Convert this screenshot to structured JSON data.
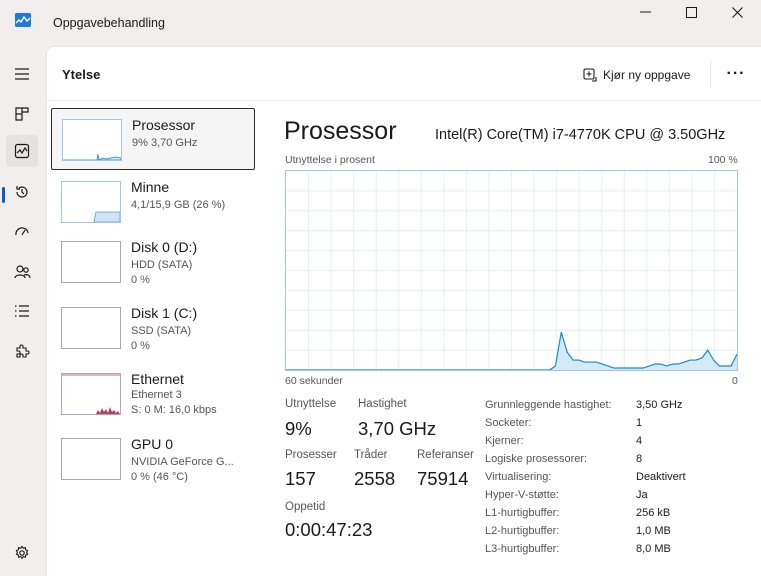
{
  "window": {
    "title": "Oppgavebehandling"
  },
  "header": {
    "title": "Ytelse",
    "run_task_label": "Kjør ny oppgave"
  },
  "devices": [
    {
      "name": "Prosessor",
      "line1": "9% 3,70 GHz"
    },
    {
      "name": "Minne",
      "line1": "4,1/15,9 GB (26 %)"
    },
    {
      "name": "Disk 0 (D:)",
      "line1": "HDD (SATA)",
      "line2": "0 %"
    },
    {
      "name": "Disk 1 (C:)",
      "line1": "SSD (SATA)",
      "line2": "0 %"
    },
    {
      "name": "Ethernet",
      "line1": "Ethernet 3",
      "line2": "S: 0 M: 16,0 kbps"
    },
    {
      "name": "GPU 0",
      "line1": "NVIDIA GeForce G...",
      "line2": "0 % (46 °C)"
    }
  ],
  "detail": {
    "title": "Prosessor",
    "model": "Intel(R) Core(TM) i7-4770K CPU @ 3.50GHz",
    "graph_label": "Utnyttelse i prosent",
    "graph_max": "100 %",
    "graph_time": "60 sekunder",
    "graph_min": "0",
    "stats": {
      "util_label": "Utnyttelse",
      "util_value": "9%",
      "speed_label": "Hastighet",
      "speed_value": "3,70 GHz",
      "proc_label": "Prosesser",
      "proc_value": "157",
      "threads_label": "Tråder",
      "threads_value": "2558",
      "handles_label": "Referanser",
      "handles_value": "75914",
      "uptime_label": "Oppetid",
      "uptime_value": "0:00:47:23"
    },
    "info": [
      {
        "key": "Grunnleggende hastighet:",
        "value": "3,50 GHz"
      },
      {
        "key": "Socketer:",
        "value": "1"
      },
      {
        "key": "Kjerner:",
        "value": "4"
      },
      {
        "key": "Logiske prosessorer:",
        "value": "8"
      },
      {
        "key": "Virtualisering:",
        "value": "Deaktivert"
      },
      {
        "key": "Hyper-V-støtte:",
        "value": "Ja"
      },
      {
        "key": "L1-hurtigbuffer:",
        "value": "256 kB"
      },
      {
        "key": "L2-hurtigbuffer:",
        "value": "1,0 MB"
      },
      {
        "key": "L3-hurtigbuffer:",
        "value": "8,0 MB"
      }
    ]
  },
  "cpu_history": [
    0,
    0,
    0,
    0,
    0,
    0,
    0,
    0,
    0,
    0,
    0,
    0,
    0,
    0,
    0,
    0,
    0,
    0,
    0,
    0,
    0,
    0,
    0,
    0,
    0,
    0,
    0,
    0,
    0,
    0,
    0,
    0,
    0,
    0,
    0,
    0,
    0,
    0,
    0,
    0,
    0,
    0,
    0,
    0,
    0,
    0,
    2,
    19,
    9,
    5,
    5,
    4,
    4,
    4,
    3,
    2,
    1,
    1,
    1,
    1,
    1,
    1,
    2,
    3,
    3,
    2,
    3,
    3,
    4,
    5,
    5,
    6,
    10,
    5,
    2,
    2,
    2,
    8
  ],
  "colors": {
    "accent": "#0b5fba",
    "cpu_line": "#1a8bc9",
    "cpu_fill": "#d3e9f7",
    "grid": "#e8eef4",
    "ethernet": "#b23e5e"
  }
}
